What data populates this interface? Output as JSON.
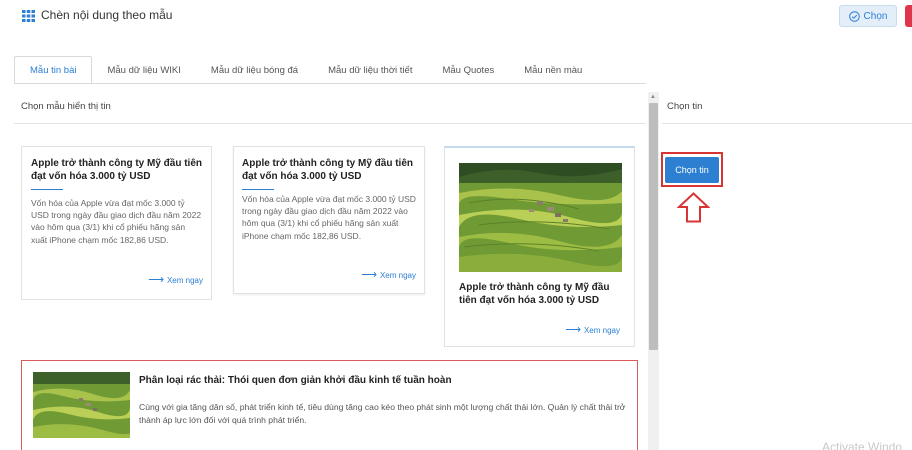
{
  "header": {
    "title": "Chèn nội dung theo mẫu",
    "chon_label": "Chọn"
  },
  "tabs": [
    {
      "label": "Mẫu tin bài",
      "active": true
    },
    {
      "label": "Mẫu dữ liệu WIKI"
    },
    {
      "label": "Mẫu dữ liệu bóng đá"
    },
    {
      "label": "Mẫu dữ liệu thời tiết"
    },
    {
      "label": "Mẫu Quotes"
    },
    {
      "label": "Mẫu nền màu"
    }
  ],
  "left_panel": {
    "title": "Chọn mẫu hiển thị tin",
    "cards": [
      {
        "title": "Apple trở thành công ty Mỹ đầu tiên đạt vốn hóa 3.000 tỷ USD",
        "body": "Vốn hóa của Apple vừa đạt mốc 3.000 tỷ USD trong ngày đầu giao dịch đầu năm 2022 vào hôm qua (3/1) khi cổ phiếu hãng sản xuất iPhone chạm mốc 182,86 USD.",
        "link": "Xem ngay"
      },
      {
        "title": "Apple trở thành công ty Mỹ đầu tiên đạt vốn hóa 3.000 tỷ USD",
        "body": "Vốn hóa của Apple vừa đạt mốc 3.000 tỷ USD trong ngày đầu giao dịch đầu năm 2022 vào hôm qua (3/1) khi cổ phiếu hãng sản xuất iPhone chạm mốc 182,86 USD.",
        "link": "Xem ngay"
      },
      {
        "title": "Apple trở thành công ty Mỹ đầu tiên đạt vốn hóa 3.000 tỷ USD",
        "link": "Xem ngay"
      }
    ],
    "feature_item": {
      "title": "Phân loại rác thải: Thói quen đơn giản khởi đầu kinh tế tuần hoàn",
      "desc": "Cùng với gia tăng dân số, phát triển kinh tế, tiêu dùng tăng cao kéo theo phát sinh một lượng chất thải lớn. Quản lý chất thải trở thành áp lực lớn đối với quá trình phát triển."
    }
  },
  "right_panel": {
    "title": "Chọn tin",
    "button_label": "Chọn tin"
  },
  "watermark": "Activate Windo",
  "colors": {
    "accent": "#2b7fd4",
    "highlight": "#d93434"
  }
}
